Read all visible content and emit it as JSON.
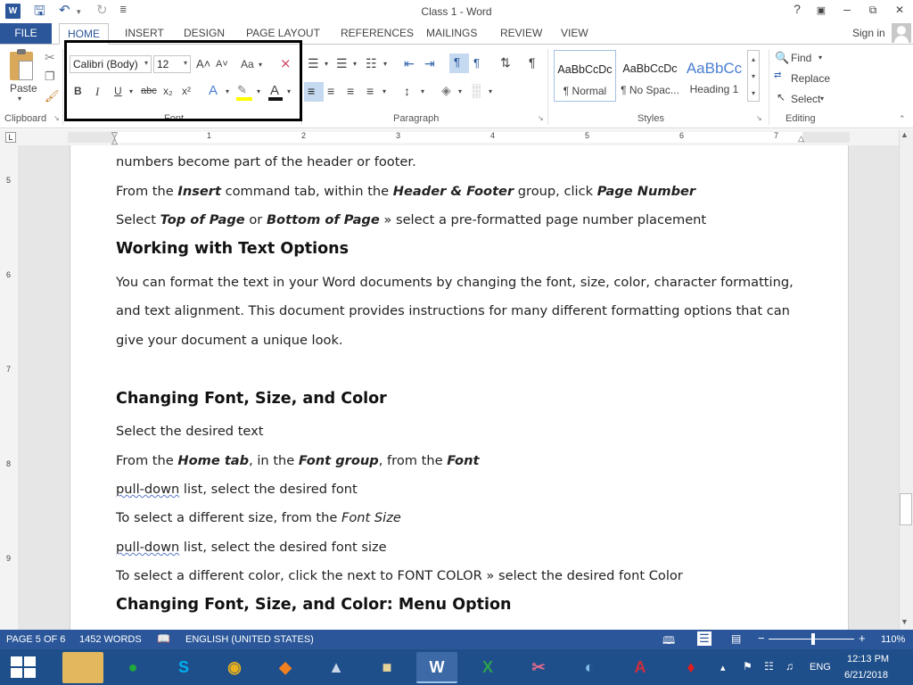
{
  "window": {
    "title": "Class 1 - Word",
    "help": "?",
    "minimize": "–",
    "restore": "⧉",
    "close": "✕"
  },
  "quick_access": {
    "save_icon": "save-icon",
    "undo_icon": "undo-icon",
    "redo_icon": "redo-icon"
  },
  "tabs": [
    "FILE",
    "HOME",
    "INSERT",
    "DESIGN",
    "PAGE LAYOUT",
    "REFERENCES",
    "MAILINGS",
    "REVIEW",
    "VIEW"
  ],
  "signin": "Sign in",
  "ribbon": {
    "clipboard": {
      "paste": "Paste",
      "label": "Clipboard"
    },
    "font": {
      "name": "Calibri (Body)",
      "size": "12",
      "label": "Font",
      "bold": "B",
      "italic": "I",
      "underline": "U",
      "strike": "abc",
      "subscript": "x₂",
      "superscript": "x²",
      "grow": "A˄",
      "shrink": "A˅",
      "case": "Aa",
      "font_color": "A"
    },
    "paragraph": {
      "label": "Paragraph"
    },
    "styles": {
      "label": "Styles",
      "items": [
        {
          "preview": "AaBbCcDc",
          "name": "¶ Normal"
        },
        {
          "preview": "AaBbCcDc",
          "name": "¶ No Spac..."
        },
        {
          "preview": "AaBbCc",
          "name": "Heading 1"
        }
      ]
    },
    "editing": {
      "label": "Editing",
      "find": "Find",
      "replace": "Replace",
      "select": "Select"
    }
  },
  "ruler": {
    "numbers": [
      "1",
      "2",
      "3",
      "4",
      "5",
      "6",
      "7"
    ],
    "vnumbers": [
      "5",
      "6",
      "7",
      "8",
      "9"
    ]
  },
  "document": {
    "l1": "numbers become part of the header or footer.",
    "l2a": "From the ",
    "l2b": "Insert",
    "l2c": " command tab, within the ",
    "l2d": "Header & Footer",
    "l2e": " group, click ",
    "l2f": "Page Number",
    "l3a": "Select ",
    "l3b": "Top of Page",
    "l3c": " or ",
    "l3d": "Bottom of Page",
    "l3e": " » select a pre-formatted page number placement",
    "h1": "Working with Text Options",
    "p1": "You can format the text in your Word documents by changing the font, size, color, character formatting,",
    "p2": "and text alignment. This document provides instructions for many different formatting options that can",
    "p3": "give your document a unique look.",
    "h2": "Changing Font, Size, and Color",
    "l4": "Select the desired text",
    "l5a": "From the ",
    "l5b": "Home tab",
    "l5c": ", in the ",
    "l5d": "Font group",
    "l5e": ", from the ",
    "l5f": "Font",
    "l6a": "pull-down",
    "l6b": " list, select the desired font",
    "l7a": "To select a different size, from the ",
    "l7b": "Font Size",
    "l8a": "pull-down",
    "l8b": " list, select the desired font size",
    "l9": "To select a different color, click the next to FONT COLOR » select the desired font Color",
    "h3": "Changing Font, Size, and Color: Menu Option"
  },
  "status": {
    "page": "PAGE 5 OF 6",
    "words": "1452 WORDS",
    "language": "ENGLISH (UNITED STATES)",
    "zoom": "110%"
  },
  "taskbar": {
    "lang": "ENG",
    "time": "12:13 PM",
    "date": "6/21/2018"
  }
}
